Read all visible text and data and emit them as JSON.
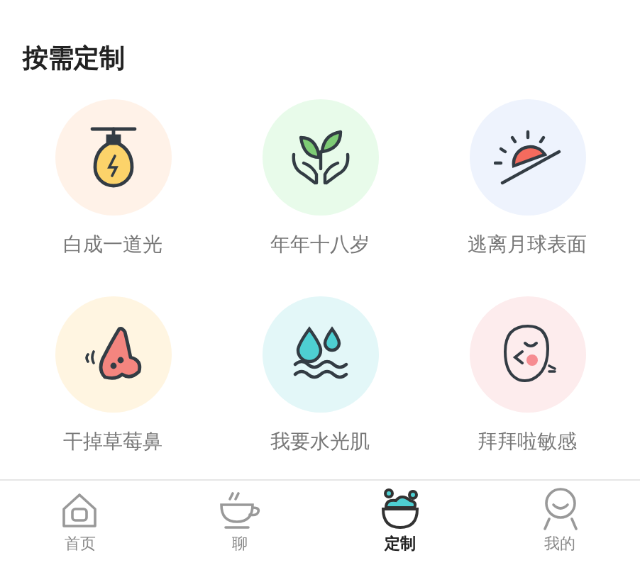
{
  "header": {
    "title": "按需定制"
  },
  "options": [
    {
      "label": "白成一道光",
      "kind": "bulb",
      "color": "#fff2e8"
    },
    {
      "label": "年年十八岁",
      "kind": "sprout",
      "color": "#e8fbea"
    },
    {
      "label": "逃离月球表面",
      "kind": "sunrise",
      "color": "#eef3fd"
    },
    {
      "label": "干掉草莓鼻",
      "kind": "nose",
      "color": "#fff5e1"
    },
    {
      "label": "我要水光肌",
      "kind": "water",
      "color": "#e3f7f8"
    },
    {
      "label": "拜拜啦敏感",
      "kind": "face",
      "color": "#fdeced"
    }
  ],
  "tabs": [
    {
      "label": "首页",
      "kind": "home",
      "selected": false
    },
    {
      "label": "聊",
      "kind": "cup",
      "selected": false
    },
    {
      "label": "定制",
      "kind": "bowl",
      "selected": true
    },
    {
      "label": "我的",
      "kind": "person",
      "selected": false
    }
  ]
}
